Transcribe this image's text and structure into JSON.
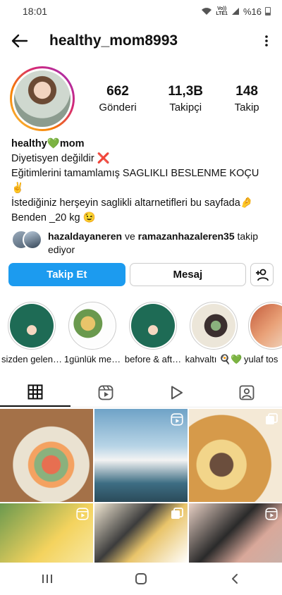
{
  "status_bar": {
    "time": "18:01",
    "network_label_top": "Vo))",
    "network_label_bottom": "LTE1",
    "battery_text": "%16"
  },
  "header": {
    "username": "healthy_mom8993"
  },
  "stats": [
    {
      "value": "662",
      "label": "Gönderi"
    },
    {
      "value": "11,3B",
      "label": "Takipçi"
    },
    {
      "value": "148",
      "label": "Takip"
    }
  ],
  "bio": {
    "name_part1": "healthy",
    "name_emoji": "💚",
    "name_part2": "mom",
    "line1": "Diyetisyen değildir ❌",
    "line2": "Eğitimlerini tamamlamış SAGLIKLI BESLENME KOÇU",
    "line3": "✌",
    "line4": "İstediğiniz herşeyin saglikli altarnetifleri bu sayfada🤌",
    "line5": "Benden  _20 kg  😉"
  },
  "followed_by": {
    "user1": "hazaldayaneren",
    "connector": " ve ",
    "user2": "ramazanhazaleren35",
    "suffix": " takip ediyor"
  },
  "actions": {
    "follow_label": "Takip Et",
    "message_label": "Mesaj"
  },
  "highlights": [
    {
      "label": "sizden gelen…"
    },
    {
      "label": "1günlük me…"
    },
    {
      "label": "before & aft…"
    },
    {
      "label": "kahvaltı 🍳💚"
    },
    {
      "label": "yulaf tos"
    }
  ],
  "tabs": [
    {
      "icon": "grid-icon"
    },
    {
      "icon": "reels-icon"
    },
    {
      "icon": "play-icon"
    },
    {
      "icon": "tagged-icon"
    }
  ],
  "colors": {
    "accent": "#1c9bef",
    "text": "#111111"
  }
}
